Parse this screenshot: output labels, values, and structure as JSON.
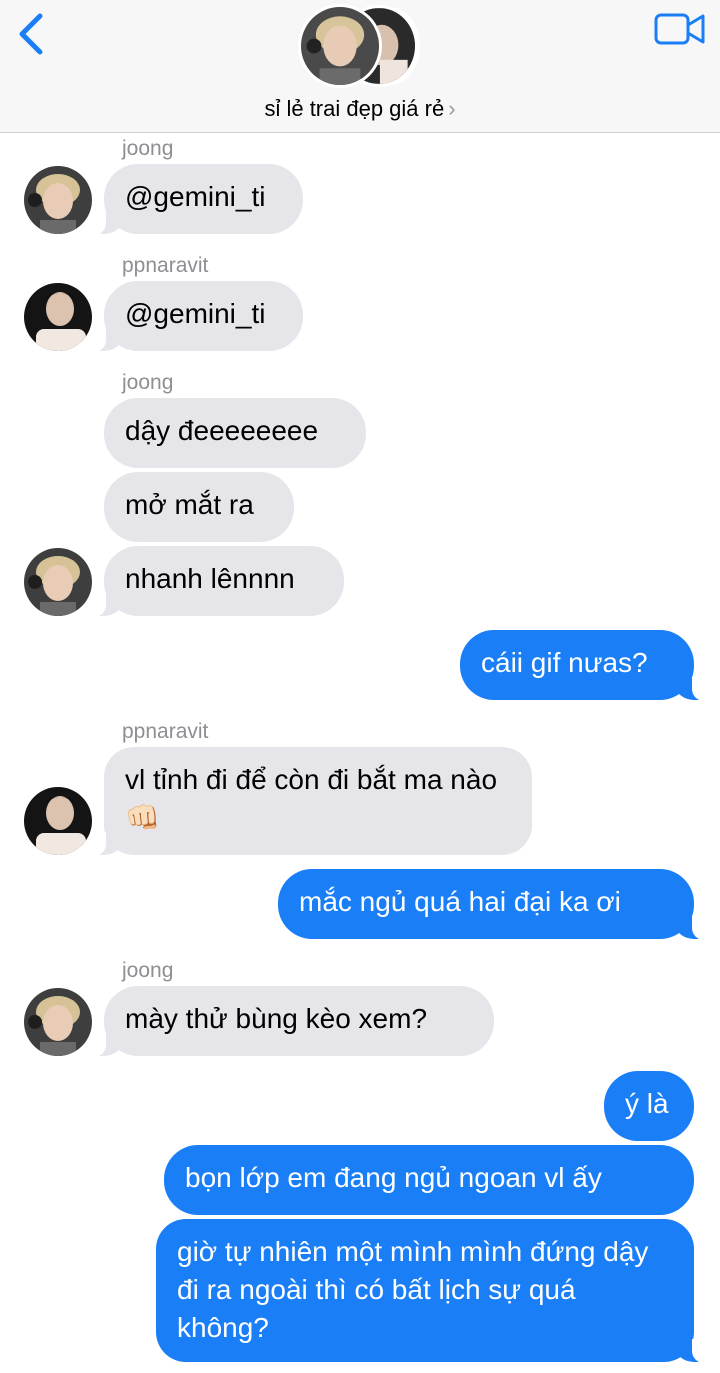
{
  "header": {
    "title": "sỉ lẻ trai đẹp giá rẻ",
    "title_chevron": "›",
    "back_icon": "chevron-left-icon",
    "video_icon": "video-camera-icon",
    "accent_color": "#1a7ff7"
  },
  "messages": [
    {
      "sender": "joong",
      "text": "@gemini_ti"
    },
    {
      "sender": "ppnaravit",
      "text": "@gemini_ti"
    },
    {
      "sender": "joong",
      "text": "dậy đeeeeeeee"
    },
    {
      "text": "mở mắt ra"
    },
    {
      "text": "nhanh lênnnn"
    },
    {
      "text": "cáii gif nưas?"
    },
    {
      "sender": "ppnaravit",
      "text": "vl tỉnh đi để còn đi bắt ma nào👊🏻"
    },
    {
      "text": "mắc ngủ quá hai đại ka ơi"
    },
    {
      "sender": "joong",
      "text": "mày thử bùng kèo xem?"
    },
    {
      "text": "ý là"
    },
    {
      "text": "bọn lớp em đang ngủ ngoan vl ấy"
    },
    {
      "text": "giờ tự nhiên một mình mình đứng dậy đi ra ngoài thì có bất lịch sự quá không?"
    }
  ]
}
